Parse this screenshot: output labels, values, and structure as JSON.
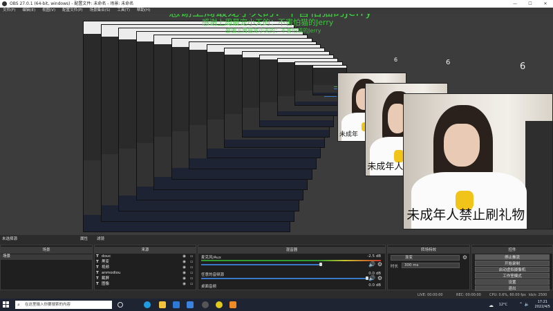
{
  "window": {
    "title": "OBS 27.0.1 (64-bit, windows) - 配置文件: 未命名 - 场景: 未命名",
    "minimize": "—",
    "maximize": "☐",
    "close": "✕"
  },
  "menu": [
    "文件(F)",
    "编辑(E)",
    "视图(V)",
    "配置文件(P)",
    "场景集合(S)",
    "工具(T)",
    "帮助(H)"
  ],
  "preview": {
    "banner": "感谢上周最宠小天的：不害怕猫的Jerry",
    "caption": "未成年人禁止刷礼物",
    "counter": "6",
    "inner_caption_1": "未成年人",
    "inner_caption_2": "未成年"
  },
  "dock": {
    "no_source": "未选择源",
    "properties": "属性",
    "filters": "滤镜",
    "scenes": {
      "header": "场景",
      "items": [
        "场景"
      ]
    },
    "sources": {
      "header": "来源",
      "items": [
        "douc",
        "黑变",
        "视频",
        "anmodiou",
        "截屏",
        "图像"
      ]
    },
    "mixer": {
      "header": "混音器",
      "tracks": [
        {
          "name": "麦克风/Aux",
          "db": "-2.5 dB",
          "level": 0.72
        },
        {
          "name": "桌面音频",
          "db": "0.0 dB",
          "level": 0.0
        }
      ],
      "extra_label": "任意的音频源",
      "extra_db": "0.0 dB"
    },
    "transitions": {
      "header": "转场特效",
      "type": "渐变",
      "duration_label": "时长",
      "duration": "300 ms"
    },
    "controls": {
      "header": "控件",
      "buttons": [
        "停止推流",
        "开始录制",
        "启动虚拟摄像机",
        "工作室模式",
        "设置",
        "退出"
      ]
    }
  },
  "status": {
    "live": "LIVE: 00:00:00",
    "rec": "REC: 00:00:00",
    "cpu": "CPU: 0.6%, 60.00 fps",
    "kbps": "kb/s: 2500"
  },
  "taskbar": {
    "search_placeholder": "在这里输入你要搜索的内容",
    "temperature": "12°C",
    "time": "17:21",
    "date": "2022/4/5",
    "icons": [
      "task-view",
      "edge",
      "file-explorer",
      "store",
      "mail",
      "obs",
      "chrome",
      "app-orange"
    ]
  }
}
